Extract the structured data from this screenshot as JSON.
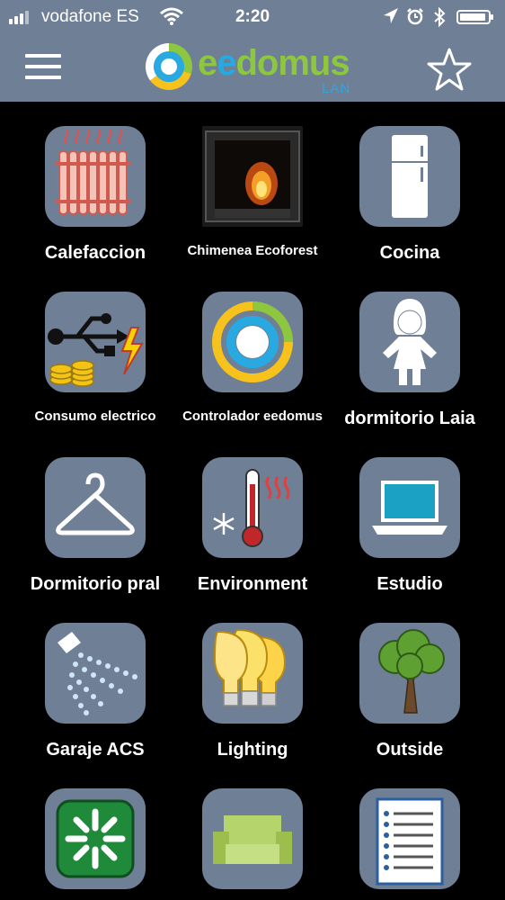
{
  "status_bar": {
    "carrier": "vodafone ES",
    "time": "2:20"
  },
  "header": {
    "logo_text": "eedomus",
    "logo_sub": "LAN"
  },
  "tiles": [
    {
      "label": "Calefaccion",
      "icon": "radiator-icon"
    },
    {
      "label": "Chimenea Ecoforest",
      "icon": "fireplace-photo"
    },
    {
      "label": "Cocina",
      "icon": "fridge-icon"
    },
    {
      "label": "Consumo electrico",
      "icon": "usb-power-coins-icon"
    },
    {
      "label": "Controlador eedomus",
      "icon": "eedomus-ring-icon"
    },
    {
      "label": "dormitorio Laia",
      "icon": "girl-icon"
    },
    {
      "label": "Dormitorio pral",
      "icon": "hanger-icon"
    },
    {
      "label": "Environment",
      "icon": "thermometer-icon"
    },
    {
      "label": "Estudio",
      "icon": "laptop-icon"
    },
    {
      "label": "Garaje ACS",
      "icon": "shower-icon"
    },
    {
      "label": "Lighting",
      "icon": "light-bulbs-icon"
    },
    {
      "label": "Outside",
      "icon": "tree-icon"
    },
    {
      "label": "",
      "icon": "green-burst-icon"
    },
    {
      "label": "",
      "icon": "sofa-icon"
    },
    {
      "label": "",
      "icon": "document-list-icon"
    }
  ],
  "colors": {
    "bar": "#6f7f95",
    "tile": "#6f7f95",
    "background": "#000000",
    "brand_green": "#8dc63f",
    "brand_blue": "#29a9e1"
  }
}
